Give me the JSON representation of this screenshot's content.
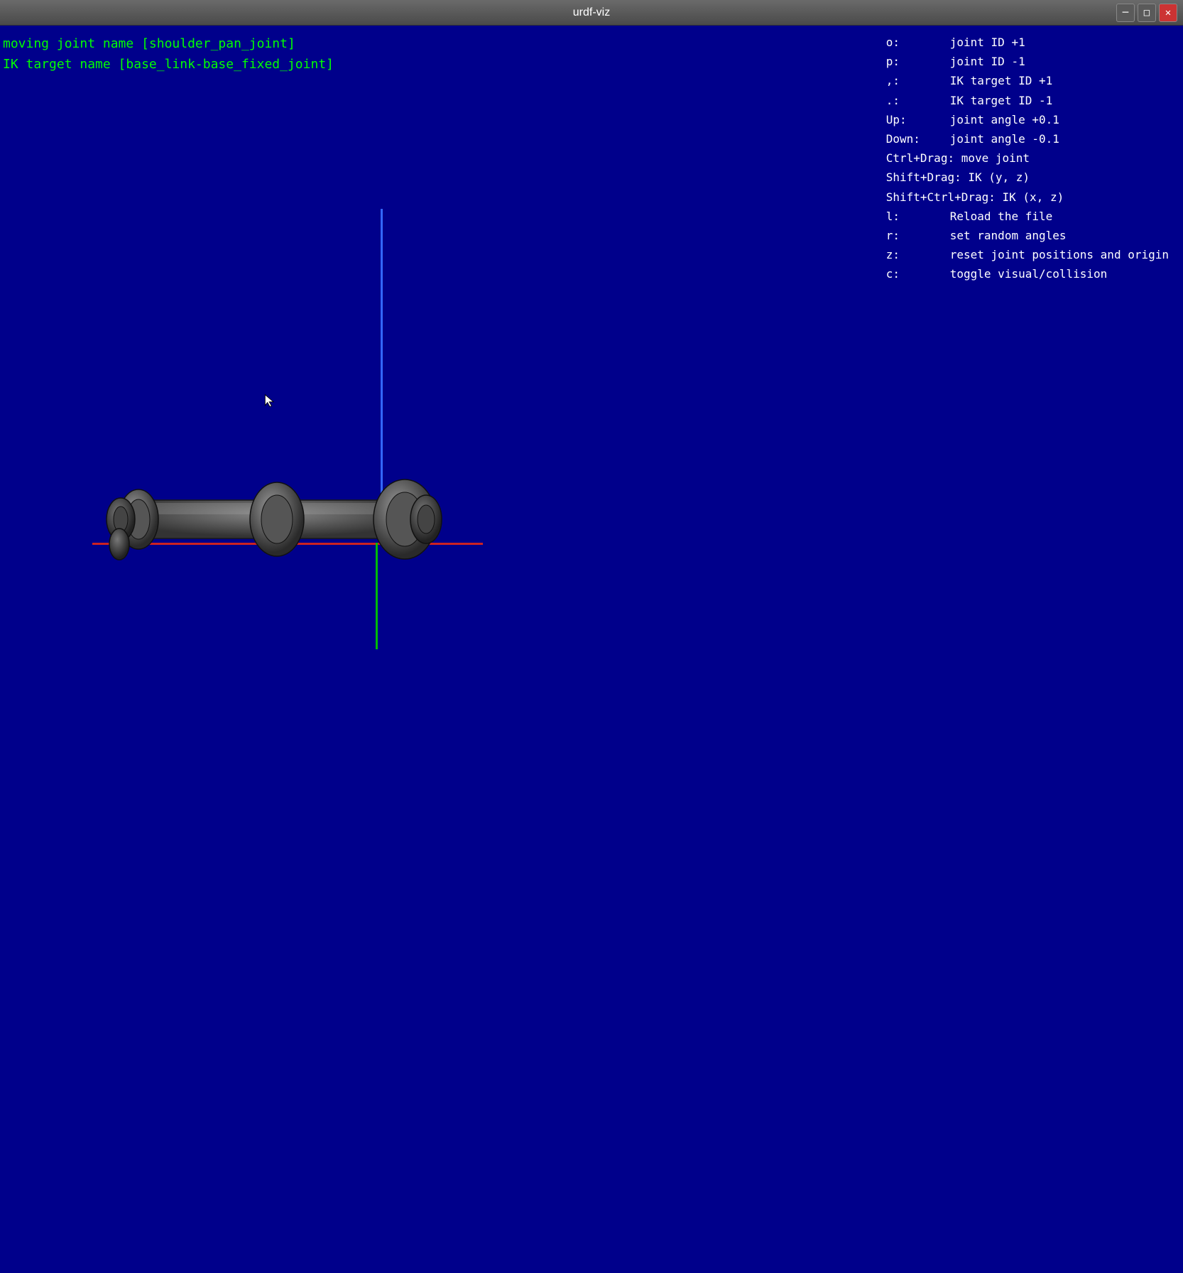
{
  "titlebar": {
    "title": "urdf-viz",
    "minimize_label": "─",
    "maximize_label": "□",
    "close_label": "✕"
  },
  "info": {
    "moving_joint_label": "moving joint name [shoulder_pan_joint]",
    "ik_target_label": "IK target name [base_link-base_fixed_joint]"
  },
  "shortcuts": [
    {
      "key": "o:    ",
      "desc": "joint ID +1"
    },
    {
      "key": "p:    ",
      "desc": "joint ID -1"
    },
    {
      "key": ",:    ",
      "desc": "IK target ID +1"
    },
    {
      "key": ".:    ",
      "desc": "IK target ID -1"
    },
    {
      "key": "Up:   ",
      "desc": "joint angle +0.1"
    },
    {
      "key": "Down: ",
      "desc": "joint angle -0.1"
    },
    {
      "key": "Ctrl+Drag: ",
      "desc": "move joint"
    },
    {
      "key": "Shift+Drag: ",
      "desc": "IK (y, z)"
    },
    {
      "key": "Shift+Ctrl+Drag: ",
      "desc": "IK (x, z)"
    },
    {
      "key": "l:    ",
      "desc": "Reload the file"
    },
    {
      "key": "r:    ",
      "desc": "set random angles"
    },
    {
      "key": "z:    ",
      "desc": "reset joint positions and origin"
    },
    {
      "key": "c:    ",
      "desc": "toggle visual/collision"
    }
  ]
}
